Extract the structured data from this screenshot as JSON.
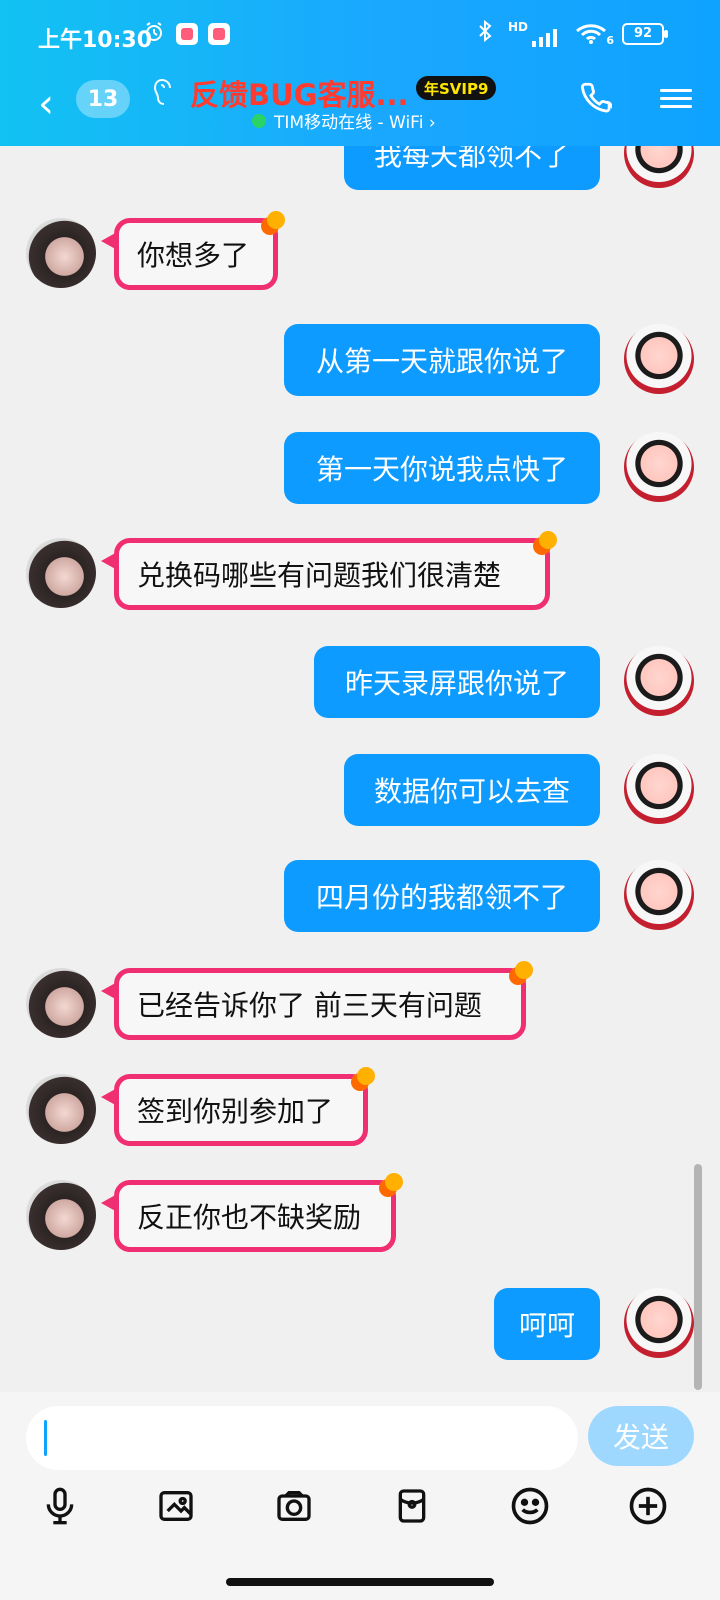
{
  "status": {
    "time": "上午10:30",
    "battery": "92",
    "hd": "HD",
    "wifi_band": "6"
  },
  "header": {
    "back_icon": "chevron-left-icon",
    "unread_count": "13",
    "title": "反馈BUG客服...",
    "svip": "年SVIP9",
    "online_text": "TIM移动在线 - WiFi ›",
    "call_icon": "phone-icon",
    "menu_icon": "menu-icon"
  },
  "messages": [
    {
      "side": "right",
      "text": "我每天都领不了"
    },
    {
      "side": "left",
      "text": "你想多了"
    },
    {
      "side": "right",
      "text": "从第一天就跟你说了"
    },
    {
      "side": "right",
      "text": "第一天你说我点快了"
    },
    {
      "side": "left",
      "text": "兑换码哪些有问题我们很清楚"
    },
    {
      "side": "right",
      "text": "昨天录屏跟你说了"
    },
    {
      "side": "right",
      "text": "数据你可以去查"
    },
    {
      "side": "right",
      "text": "四月份的我都领不了"
    },
    {
      "side": "left",
      "text": "已经告诉你了 前三天有问题"
    },
    {
      "side": "left",
      "text": "签到你别参加了"
    },
    {
      "side": "left",
      "text": "反正你也不缺奖励"
    },
    {
      "side": "right",
      "text": "呵呵"
    }
  ],
  "composer": {
    "input_value": "",
    "send_label": "发送",
    "tools": [
      {
        "name": "microphone-icon"
      },
      {
        "name": "image-icon"
      },
      {
        "name": "camera-icon"
      },
      {
        "name": "red-packet-icon"
      },
      {
        "name": "emoji-icon"
      },
      {
        "name": "plus-icon"
      }
    ]
  }
}
